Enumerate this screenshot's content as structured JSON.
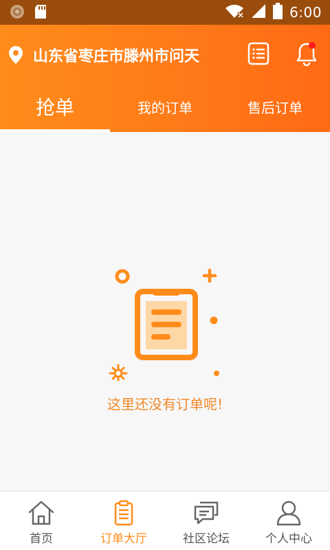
{
  "status_bar": {
    "time": "6:00",
    "icons": [
      "app-badge-icon",
      "sd-card-icon",
      "wifi-icon",
      "signal-icon",
      "battery-icon"
    ]
  },
  "header": {
    "location": "山东省枣庄市滕州市问天",
    "icons": [
      "location-pin-icon",
      "list-icon",
      "bell-icon"
    ],
    "notification_dot_color": "#ff1a1a"
  },
  "tabs": [
    {
      "label": "抢单",
      "active": true
    },
    {
      "label": "我的订单",
      "active": false
    },
    {
      "label": "售后订单",
      "active": false
    }
  ],
  "empty_state": {
    "message": "这里还没有订单呢!",
    "icon": "clipboard-icon"
  },
  "bottom_nav": [
    {
      "label": "首页",
      "icon": "home-icon",
      "active": false
    },
    {
      "label": "订单大厅",
      "icon": "order-hall-icon",
      "active": true
    },
    {
      "label": "社区论坛",
      "icon": "chat-icon",
      "active": false
    },
    {
      "label": "个人中心",
      "icon": "user-icon",
      "active": false
    }
  ],
  "colors": {
    "accent": "#ff8c1a",
    "status_bar": "#9a4c0c",
    "empty_text": "#f0892a"
  }
}
